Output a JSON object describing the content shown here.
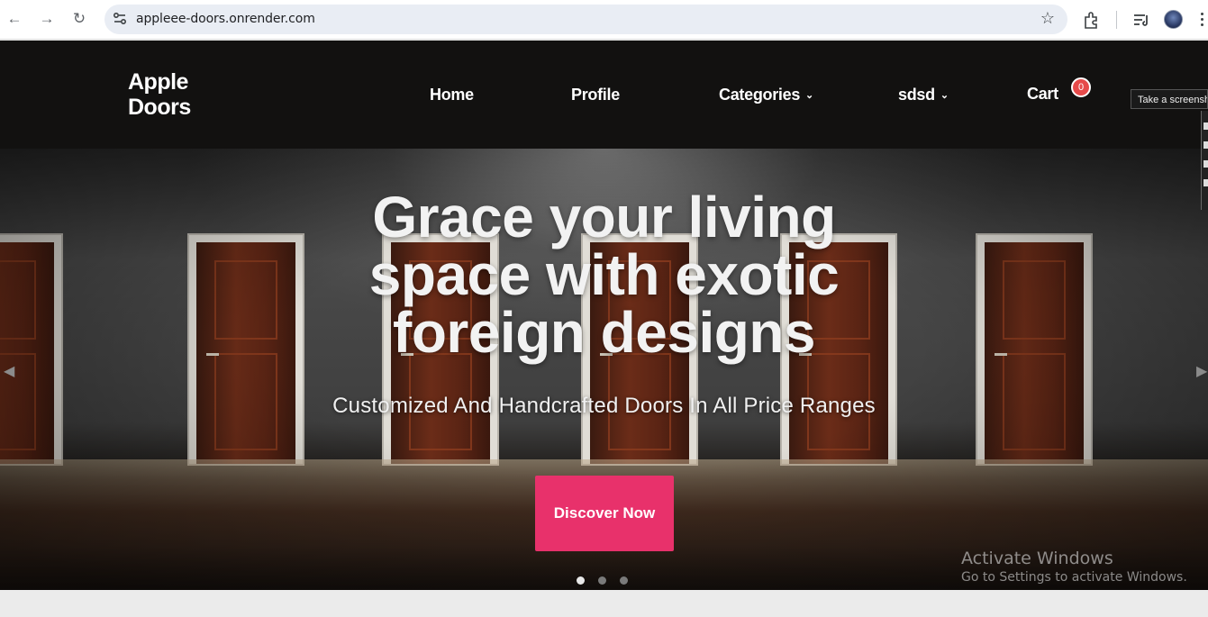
{
  "browser": {
    "url": "appleee-doors.onrender.com",
    "icons": [
      "back-arrow-icon",
      "forward-arrow-icon",
      "reload-icon",
      "site-settings-icon",
      "bookmark-star-icon",
      "extensions-icon",
      "media-queue-icon",
      "profile-avatar",
      "more-options-icon"
    ]
  },
  "header": {
    "logo_line1": "Apple",
    "logo_line2": "Doors",
    "nav": {
      "home": "Home",
      "profile": "Profile",
      "categories": "Categories",
      "sdsd": "sdsd",
      "cart": "Cart",
      "cart_count": "0"
    }
  },
  "hero": {
    "heading_line1": "Grace your living",
    "heading_line2": "space with exotic",
    "heading_line3": "foreign designs",
    "subheading": "Customized And Handcrafted Doors In All Price Ranges",
    "cta_label": "Discover Now",
    "slides_total": 3,
    "active_slide": 1
  },
  "overlay": {
    "tooltip": "Take a screenshot",
    "windows_line1": "Activate Windows",
    "windows_line2": "Go to Settings to activate Windows."
  },
  "colors": {
    "header_bg": "#121110",
    "accent": "#e8316b",
    "badge": "#e64a4a"
  }
}
